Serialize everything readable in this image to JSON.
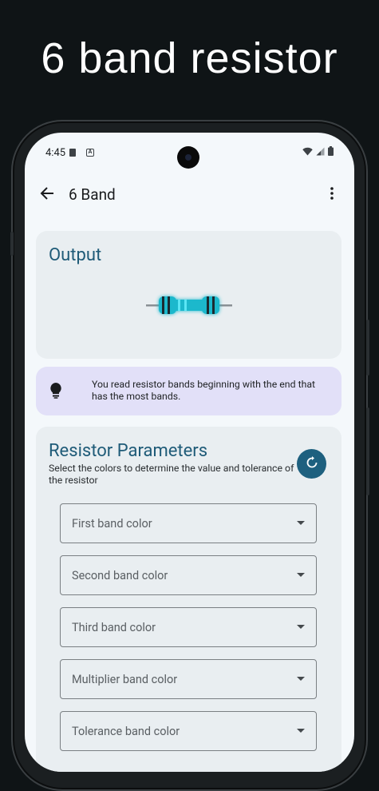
{
  "promo": {
    "title": "6 band resistor"
  },
  "status_bar": {
    "time": "4:45"
  },
  "app_bar": {
    "title": "6 Band"
  },
  "output": {
    "heading": "Output"
  },
  "tip": {
    "text": "You read resistor bands beginning with the end that has the most bands."
  },
  "parameters": {
    "heading": "Resistor Parameters",
    "subtitle": "Select the colors to determine the value and tolerance of the resistor",
    "dropdowns": [
      {
        "label": "First band color"
      },
      {
        "label": "Second band color"
      },
      {
        "label": "Third band color"
      },
      {
        "label": "Multiplier band color"
      },
      {
        "label": "Tolerance band color"
      }
    ]
  },
  "colors": {
    "accent": "#1e607f",
    "heading": "#1f5b78",
    "resistor_body": "#26c6da",
    "tip_background": "#e2e0f8"
  },
  "icons": [
    "back-arrow-icon",
    "more-vert-icon",
    "lightbulb-icon",
    "reset-icon",
    "wifi-icon",
    "signal-icon",
    "battery-icon"
  ]
}
